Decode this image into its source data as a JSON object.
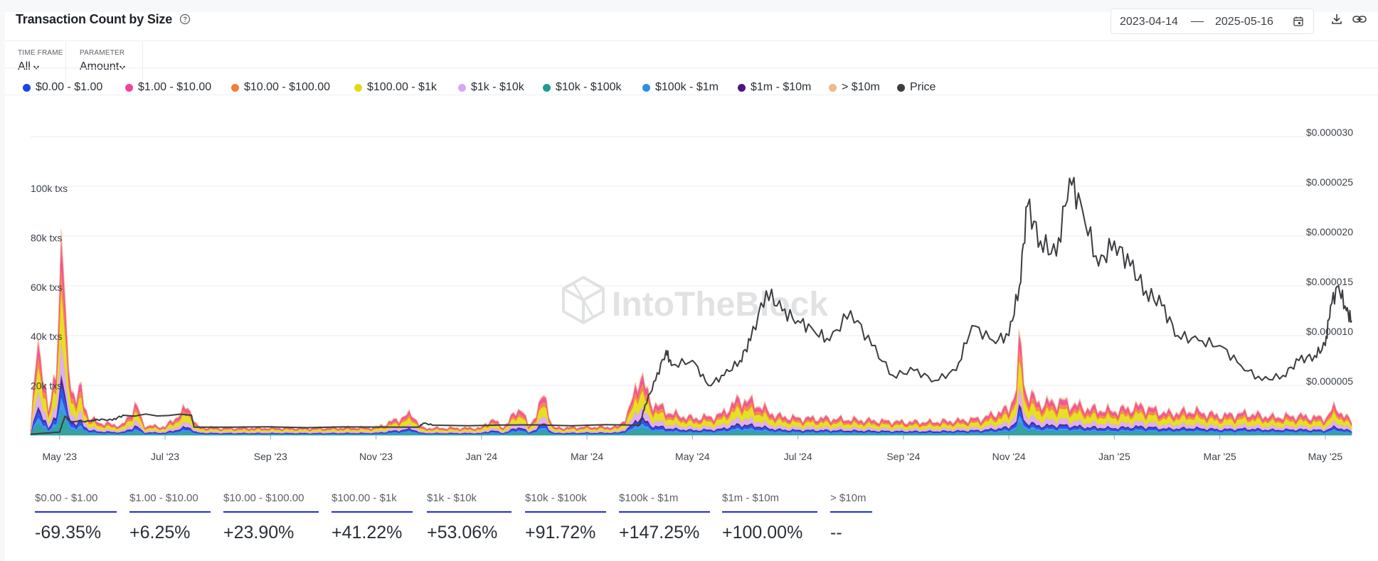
{
  "header": {
    "title": "Transaction Count by Size",
    "date_start": "2023-04-14",
    "date_end": "2025-05-16"
  },
  "filters": [
    {
      "label": "TIME FRAME",
      "value": "All"
    },
    {
      "label": "PARAMETER",
      "value": "Amount"
    }
  ],
  "legend": [
    {
      "label": "$0.00 - $1.00",
      "color": "#1a44e8"
    },
    {
      "label": "$1.00 - $10.00",
      "color": "#f2449a"
    },
    {
      "label": "$10.00 - $100.00",
      "color": "#f57e3a"
    },
    {
      "label": "$100.00 - $1k",
      "color": "#e3dc10"
    },
    {
      "label": "$1k - $10k",
      "color": "#d9a6f2"
    },
    {
      "label": "$10k - $100k",
      "color": "#1f9a95"
    },
    {
      "label": "$100k - $1m",
      "color": "#2f8ee8"
    },
    {
      "label": "$1m - $10m",
      "color": "#4a1680"
    },
    {
      "label": "> $10m",
      "color": "#f0b98a"
    },
    {
      "label": "Price",
      "color": "#3b3d40"
    }
  ],
  "watermark": "IntoTheBlock",
  "chart_data": {
    "type": "area",
    "left_axis": {
      "ticks": [
        "20k txs",
        "40k txs",
        "60k txs",
        "80k txs",
        "100k txs"
      ],
      "values": [
        20000,
        40000,
        60000,
        80000,
        100000
      ],
      "range": [
        0,
        100000
      ]
    },
    "right_axis": {
      "ticks": [
        "$0.000005",
        "$0.000010",
        "$0.000015",
        "$0.000020",
        "$0.000025",
        "$0.000030"
      ],
      "values": [
        5e-06,
        1e-05,
        1.5e-05,
        2e-05,
        2.5e-05,
        3e-05
      ],
      "range": [
        0,
        3e-05
      ]
    },
    "x_ticks": [
      "May '23",
      "Jul '23",
      "Sep '23",
      "Nov '23",
      "Jan '24",
      "Mar '24",
      "May '24",
      "Jul '24",
      "Sep '24",
      "Nov '24",
      "Jan '25",
      "Mar '25",
      "May '25"
    ],
    "x_tick_months": [
      1,
      3,
      5,
      7,
      9,
      11,
      13,
      15,
      17,
      19,
      21,
      23,
      25
    ],
    "x_range_months": [
      0.45,
      25.5
    ],
    "grid": true,
    "legend_position": "top",
    "total_peaks": [
      {
        "t": 0.45,
        "v": 2000
      },
      {
        "t": 0.55,
        "v": 30000
      },
      {
        "t": 0.62,
        "v": 40000
      },
      {
        "t": 0.7,
        "v": 25000
      },
      {
        "t": 0.8,
        "v": 7000
      },
      {
        "t": 0.95,
        "v": 35000
      },
      {
        "t": 1.0,
        "v": 60000
      },
      {
        "t": 1.05,
        "v": 91000
      },
      {
        "t": 1.1,
        "v": 45000
      },
      {
        "t": 1.2,
        "v": 25000
      },
      {
        "t": 1.3,
        "v": 13000
      },
      {
        "t": 1.4,
        "v": 20000
      },
      {
        "t": 1.55,
        "v": 7000
      },
      {
        "t": 1.8,
        "v": 5000
      },
      {
        "t": 2.2,
        "v": 4000
      },
      {
        "t": 2.45,
        "v": 13000
      },
      {
        "t": 2.6,
        "v": 4000
      },
      {
        "t": 3.0,
        "v": 3500
      },
      {
        "t": 3.45,
        "v": 12000
      },
      {
        "t": 3.6,
        "v": 3500
      },
      {
        "t": 4.0,
        "v": 3000
      },
      {
        "t": 5.0,
        "v": 3000
      },
      {
        "t": 6.0,
        "v": 3000
      },
      {
        "t": 7.0,
        "v": 3200
      },
      {
        "t": 7.7,
        "v": 9000
      },
      {
        "t": 7.85,
        "v": 3000
      },
      {
        "t": 8.5,
        "v": 3000
      },
      {
        "t": 9.0,
        "v": 3000
      },
      {
        "t": 9.2,
        "v": 7000
      },
      {
        "t": 9.4,
        "v": 3000
      },
      {
        "t": 9.75,
        "v": 12000
      },
      {
        "t": 9.9,
        "v": 3000
      },
      {
        "t": 10.2,
        "v": 17000
      },
      {
        "t": 10.35,
        "v": 3000
      },
      {
        "t": 11.0,
        "v": 3500
      },
      {
        "t": 11.6,
        "v": 3500
      },
      {
        "t": 11.8,
        "v": 10000
      },
      {
        "t": 12.0,
        "v": 26000
      },
      {
        "t": 12.2,
        "v": 14000
      },
      {
        "t": 12.6,
        "v": 9000
      },
      {
        "t": 13.0,
        "v": 7000
      },
      {
        "t": 13.5,
        "v": 8000
      },
      {
        "t": 13.9,
        "v": 15000
      },
      {
        "t": 14.2,
        "v": 13000
      },
      {
        "t": 14.6,
        "v": 8000
      },
      {
        "t": 15.0,
        "v": 7000
      },
      {
        "t": 15.5,
        "v": 7000
      },
      {
        "t": 16.0,
        "v": 6500
      },
      {
        "t": 16.5,
        "v": 6000
      },
      {
        "t": 17.0,
        "v": 5500
      },
      {
        "t": 17.5,
        "v": 5500
      },
      {
        "t": 18.0,
        "v": 6000
      },
      {
        "t": 18.5,
        "v": 7000
      },
      {
        "t": 19.0,
        "v": 11000
      },
      {
        "t": 19.15,
        "v": 20000
      },
      {
        "t": 19.22,
        "v": 44000
      },
      {
        "t": 19.3,
        "v": 18000
      },
      {
        "t": 19.6,
        "v": 13000
      },
      {
        "t": 20.0,
        "v": 14000
      },
      {
        "t": 20.5,
        "v": 11000
      },
      {
        "t": 21.0,
        "v": 10000
      },
      {
        "t": 21.5,
        "v": 12000
      },
      {
        "t": 22.0,
        "v": 9000
      },
      {
        "t": 22.5,
        "v": 10000
      },
      {
        "t": 23.0,
        "v": 8000
      },
      {
        "t": 23.5,
        "v": 9000
      },
      {
        "t": 24.0,
        "v": 7500
      },
      {
        "t": 24.5,
        "v": 8000
      },
      {
        "t": 25.0,
        "v": 7000
      },
      {
        "t": 25.2,
        "v": 12000
      },
      {
        "t": 25.35,
        "v": 8000
      },
      {
        "t": 25.5,
        "v": 6000
      }
    ],
    "stack_shares": [
      0.07,
      0.13,
      0.12,
      0.26,
      0.16,
      0.12,
      0.07,
      0.04,
      0.03
    ],
    "price_series": [
      {
        "t": 0.45,
        "v": 1e-07
      },
      {
        "t": 1.0,
        "v": 3e-07
      },
      {
        "t": 1.1,
        "v": 1.9e-06
      },
      {
        "t": 1.2,
        "v": 1.4e-06
      },
      {
        "t": 1.6,
        "v": 1.4e-06
      },
      {
        "t": 1.7,
        "v": 1.6e-06
      },
      {
        "t": 2.0,
        "v": 1.5e-06
      },
      {
        "t": 2.2,
        "v": 2e-06
      },
      {
        "t": 3.5,
        "v": 2e-06
      },
      {
        "t": 3.55,
        "v": 8e-07
      },
      {
        "t": 7.8,
        "v": 8e-07
      },
      {
        "t": 7.9,
        "v": 1.2e-06
      },
      {
        "t": 8.1,
        "v": 1e-06
      },
      {
        "t": 12.0,
        "v": 1e-06
      },
      {
        "t": 12.1,
        "v": 3e-06
      },
      {
        "t": 12.3,
        "v": 5.5e-06
      },
      {
        "t": 12.5,
        "v": 8.5e-06
      },
      {
        "t": 12.6,
        "v": 7e-06
      },
      {
        "t": 13.0,
        "v": 7.5e-06
      },
      {
        "t": 13.3,
        "v": 5e-06
      },
      {
        "t": 13.6,
        "v": 6e-06
      },
      {
        "t": 13.9,
        "v": 7.5e-06
      },
      {
        "t": 14.1,
        "v": 9.5e-06
      },
      {
        "t": 14.4,
        "v": 1.45e-05
      },
      {
        "t": 14.7,
        "v": 1.25e-05
      },
      {
        "t": 15.0,
        "v": 1.15e-05
      },
      {
        "t": 15.3,
        "v": 1.05e-05
      },
      {
        "t": 15.6,
        "v": 9.5e-06
      },
      {
        "t": 16.0,
        "v": 1.25e-05
      },
      {
        "t": 16.4,
        "v": 9e-06
      },
      {
        "t": 16.8,
        "v": 6e-06
      },
      {
        "t": 17.2,
        "v": 6.5e-06
      },
      {
        "t": 17.6,
        "v": 5.5e-06
      },
      {
        "t": 18.0,
        "v": 6.5e-06
      },
      {
        "t": 18.3,
        "v": 1.1e-05
      },
      {
        "t": 18.7,
        "v": 9.5e-06
      },
      {
        "t": 19.0,
        "v": 1e-05
      },
      {
        "t": 19.2,
        "v": 1.5e-05
      },
      {
        "t": 19.35,
        "v": 2.3e-05
      },
      {
        "t": 19.6,
        "v": 1.95e-05
      },
      {
        "t": 19.9,
        "v": 1.8e-05
      },
      {
        "t": 20.15,
        "v": 2.58e-05
      },
      {
        "t": 20.4,
        "v": 2.25e-05
      },
      {
        "t": 20.7,
        "v": 1.7e-05
      },
      {
        "t": 21.0,
        "v": 1.95e-05
      },
      {
        "t": 21.3,
        "v": 1.7e-05
      },
      {
        "t": 21.6,
        "v": 1.45e-05
      },
      {
        "t": 21.9,
        "v": 1.3e-05
      },
      {
        "t": 22.2,
        "v": 1e-05
      },
      {
        "t": 22.6,
        "v": 9.5e-06
      },
      {
        "t": 23.0,
        "v": 9e-06
      },
      {
        "t": 23.4,
        "v": 7e-06
      },
      {
        "t": 23.8,
        "v": 5.5e-06
      },
      {
        "t": 24.2,
        "v": 6e-06
      },
      {
        "t": 24.5,
        "v": 7.5e-06
      },
      {
        "t": 24.8,
        "v": 8e-06
      },
      {
        "t": 25.0,
        "v": 9e-06
      },
      {
        "t": 25.1,
        "v": 1.3e-05
      },
      {
        "t": 25.25,
        "v": 1.5e-05
      },
      {
        "t": 25.4,
        "v": 1.25e-05
      },
      {
        "t": 25.5,
        "v": 1.15e-05
      }
    ]
  },
  "stats": [
    {
      "label": "$0.00 - $1.00",
      "value": "-69.35%"
    },
    {
      "label": "$1.00 - $10.00",
      "value": "+6.25%"
    },
    {
      "label": "$10.00 - $100.00",
      "value": "+23.90%"
    },
    {
      "label": "$100.00 - $1k",
      "value": "+41.22%"
    },
    {
      "label": "$1k - $10k",
      "value": "+53.06%"
    },
    {
      "label": "$10k - $100k",
      "value": "+91.72%"
    },
    {
      "label": "$100k - $1m",
      "value": "+147.25%"
    },
    {
      "label": "$1m - $10m",
      "value": "+100.00%"
    },
    {
      "label": "> $10m",
      "value": "--"
    }
  ]
}
